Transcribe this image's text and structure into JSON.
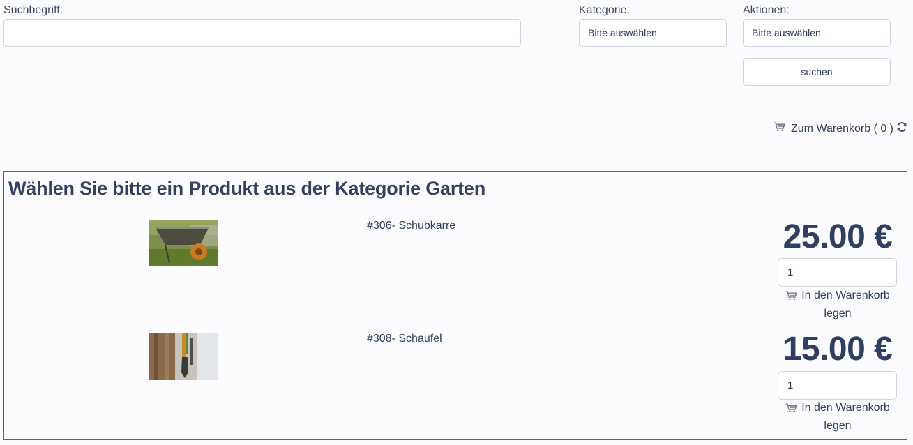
{
  "search": {
    "term_label": "Suchbegriff:",
    "term_value": "",
    "category_label": "Kategorie:",
    "category_value": "Bitte auswählen",
    "actions_label": "Aktionen:",
    "actions_value": "Bitte auswählen",
    "submit_label": "suchen"
  },
  "cart": {
    "link_label": "Zum Warenkorb ( 0 )",
    "icon": "shopping-cart-icon",
    "refresh_icon": "refresh-icon"
  },
  "panel": {
    "heading": "Wählen Sie bitte ein Produkt aus der Kategorie Garten"
  },
  "products": [
    {
      "name": "#306- Schubkarre",
      "image": "wheelbarrow-image",
      "price": "25.00 €",
      "quantity": "1",
      "add_label_line1": "In den Warenkorb",
      "add_label_line2": "legen"
    },
    {
      "name": "#308- Schaufel",
      "image": "shovel-image",
      "price": "15.00 €",
      "quantity": "1",
      "add_label_line1": "In den Warenkorb",
      "add_label_line2": "legen"
    }
  ]
}
